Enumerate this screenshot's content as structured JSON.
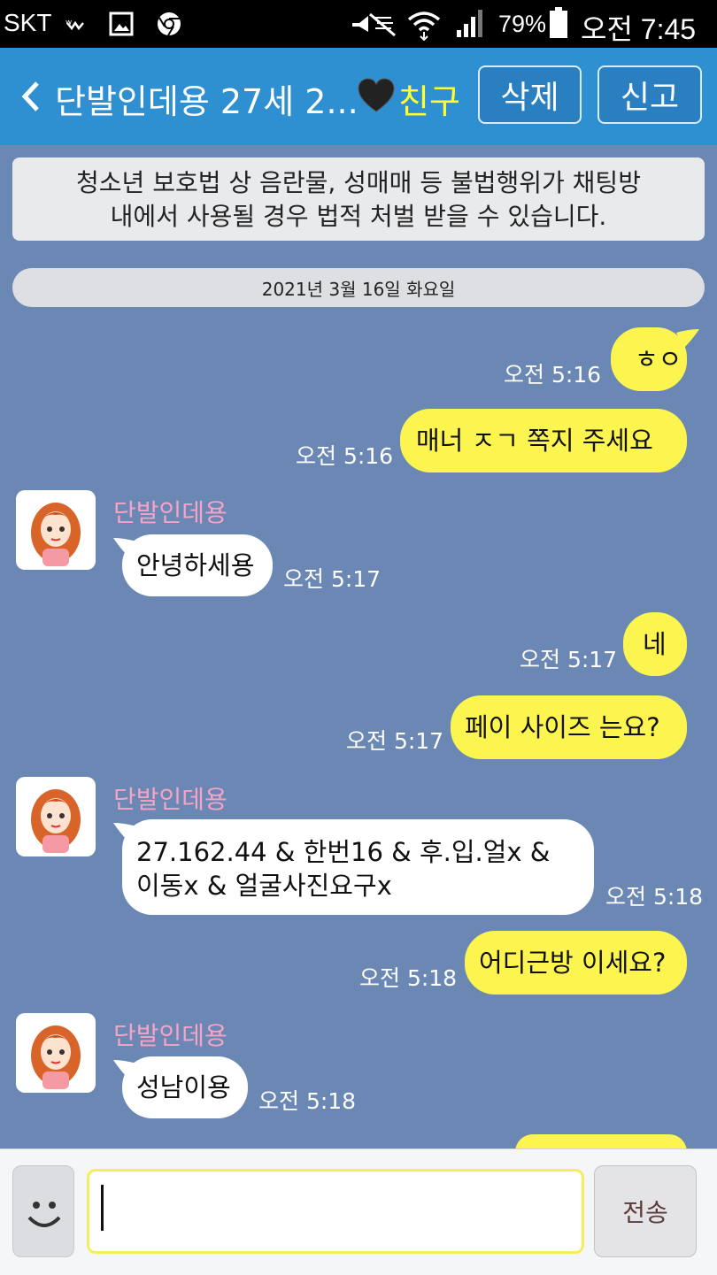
{
  "status_bar": {
    "carrier": "SKT",
    "battery": "79%",
    "time": "오전 7:45",
    "icons": [
      "wifi-calling-icon",
      "gallery-icon",
      "chrome-icon",
      "mute-icon",
      "wifi-icon",
      "signal-icon",
      "battery-icon"
    ]
  },
  "header": {
    "title": "단발인데용 27세 2...",
    "friend_label": "친구",
    "delete_label": "삭제",
    "report_label": "신고",
    "colors": {
      "bar": "#2e8fd1",
      "friend": "#ffff33"
    }
  },
  "notice": {
    "line1": "청소년 보호법 상 음란물, 성매매 등 불법행위가 채팅방",
    "line2": "내에서 사용될 경우 법적 처벌 받을 수 있습니다."
  },
  "date_separator": "2021년 3월 16일 화요일",
  "messages": [
    {
      "from": "me",
      "text": "ㅎㅇ",
      "time": "오전 5:16"
    },
    {
      "from": "me",
      "text": "매너  ㅈㄱ  쪽지 주세요",
      "time": "오전 5:16"
    },
    {
      "from": "them",
      "sender": "단발인데용",
      "text": "안녕하세용",
      "time": "오전 5:17"
    },
    {
      "from": "me",
      "text": "네",
      "time": "오전 5:17"
    },
    {
      "from": "me",
      "text": "페이  사이즈 는요?",
      "time": "오전 5:17"
    },
    {
      "from": "them",
      "sender": "단발인데용",
      "line1": "27.162.44 & 한번16 & 후.입.얼x &",
      "line2": "이동x & 얼굴사진요구x",
      "time": "오전 5:18"
    },
    {
      "from": "me",
      "text": "어디근방 이세요?",
      "time": "오전 5:18"
    },
    {
      "from": "them",
      "sender": "단발인데용",
      "text": "성남이용",
      "time": "오전 5:18"
    }
  ],
  "input": {
    "value": "",
    "send_label": "전송"
  },
  "colors": {
    "background": "#6b88b5",
    "my_bubble": "#fdf54f",
    "their_bubble": "#ffffff",
    "sender_name": "#f7a3c6"
  }
}
